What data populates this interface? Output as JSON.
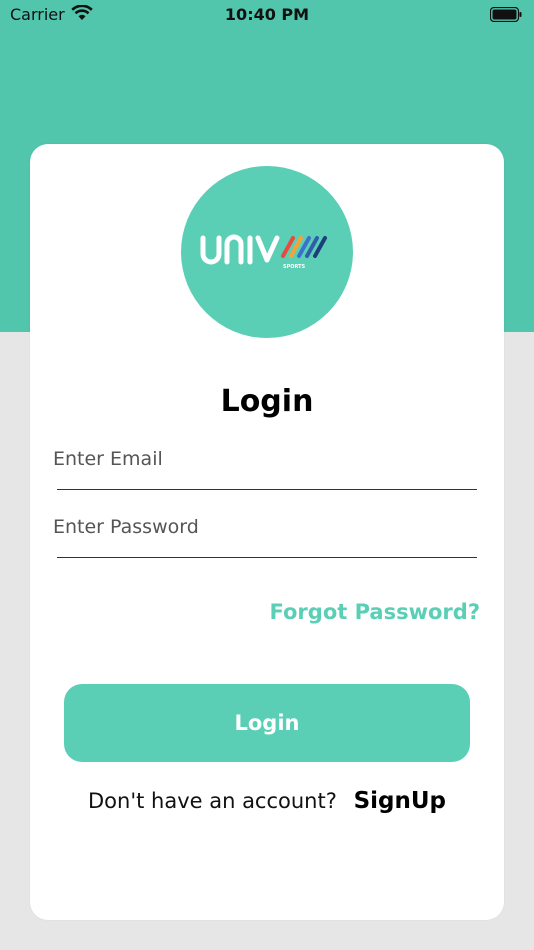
{
  "status_bar": {
    "carrier": "Carrier",
    "time": "10:40 PM"
  },
  "logo": {
    "text": "UNIV",
    "tagline": "SPORTS"
  },
  "login": {
    "title": "Login",
    "email_placeholder": "Enter Email",
    "password_placeholder": "Enter Password",
    "forgot_label": "Forgot Password?",
    "button_label": "Login",
    "no_account_text": "Don't have an account?",
    "signup_label": "SignUp"
  },
  "colors": {
    "accent": "#5bcfb6",
    "header": "#52c5ad",
    "background": "#e6e6e6"
  }
}
